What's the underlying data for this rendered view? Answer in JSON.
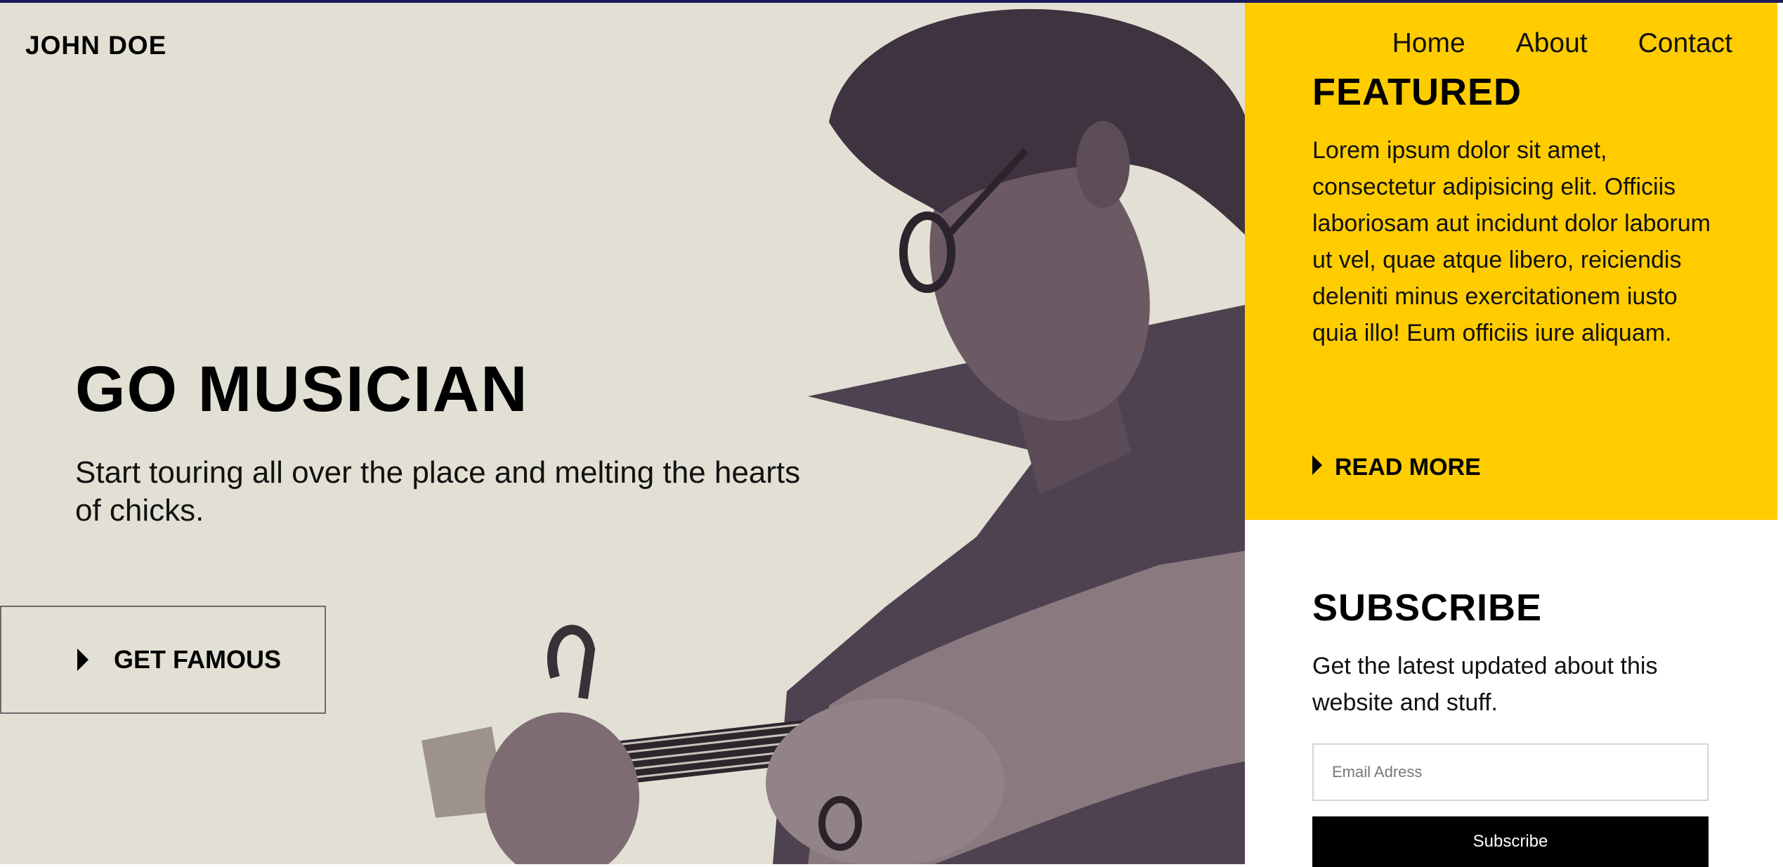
{
  "brand": {
    "logo": "JOHN DOE"
  },
  "nav": {
    "items": [
      {
        "label": "Home"
      },
      {
        "label": "About"
      },
      {
        "label": "Contact"
      }
    ]
  },
  "hero": {
    "title": "GO MUSICIAN",
    "subtitle": "Start touring all over the place and melting the hearts of chicks.",
    "cta_label": "GET FAMOUS"
  },
  "featured": {
    "title": "FEATURED",
    "body": "Lorem ipsum dolor sit amet, consectetur adipisicing elit. Officiis laboriosam aut incidunt dolor laborum ut vel, quae atque libero, reiciendis deleniti minus exercitationem iusto quia illo! Eum officiis iure aliquam.",
    "read_more_label": "READ MORE"
  },
  "subscribe": {
    "title": "SUBSCRIBE",
    "text": "Get the latest updated about this website and stuff.",
    "email_placeholder": "Email Adress",
    "email_value": "",
    "button_label": "Subscribe"
  },
  "colors": {
    "accent": "#ffcc00",
    "hero_bg": "#e2e0d4",
    "photo_tone": "#4a3d4f",
    "button_bg": "#000000"
  }
}
